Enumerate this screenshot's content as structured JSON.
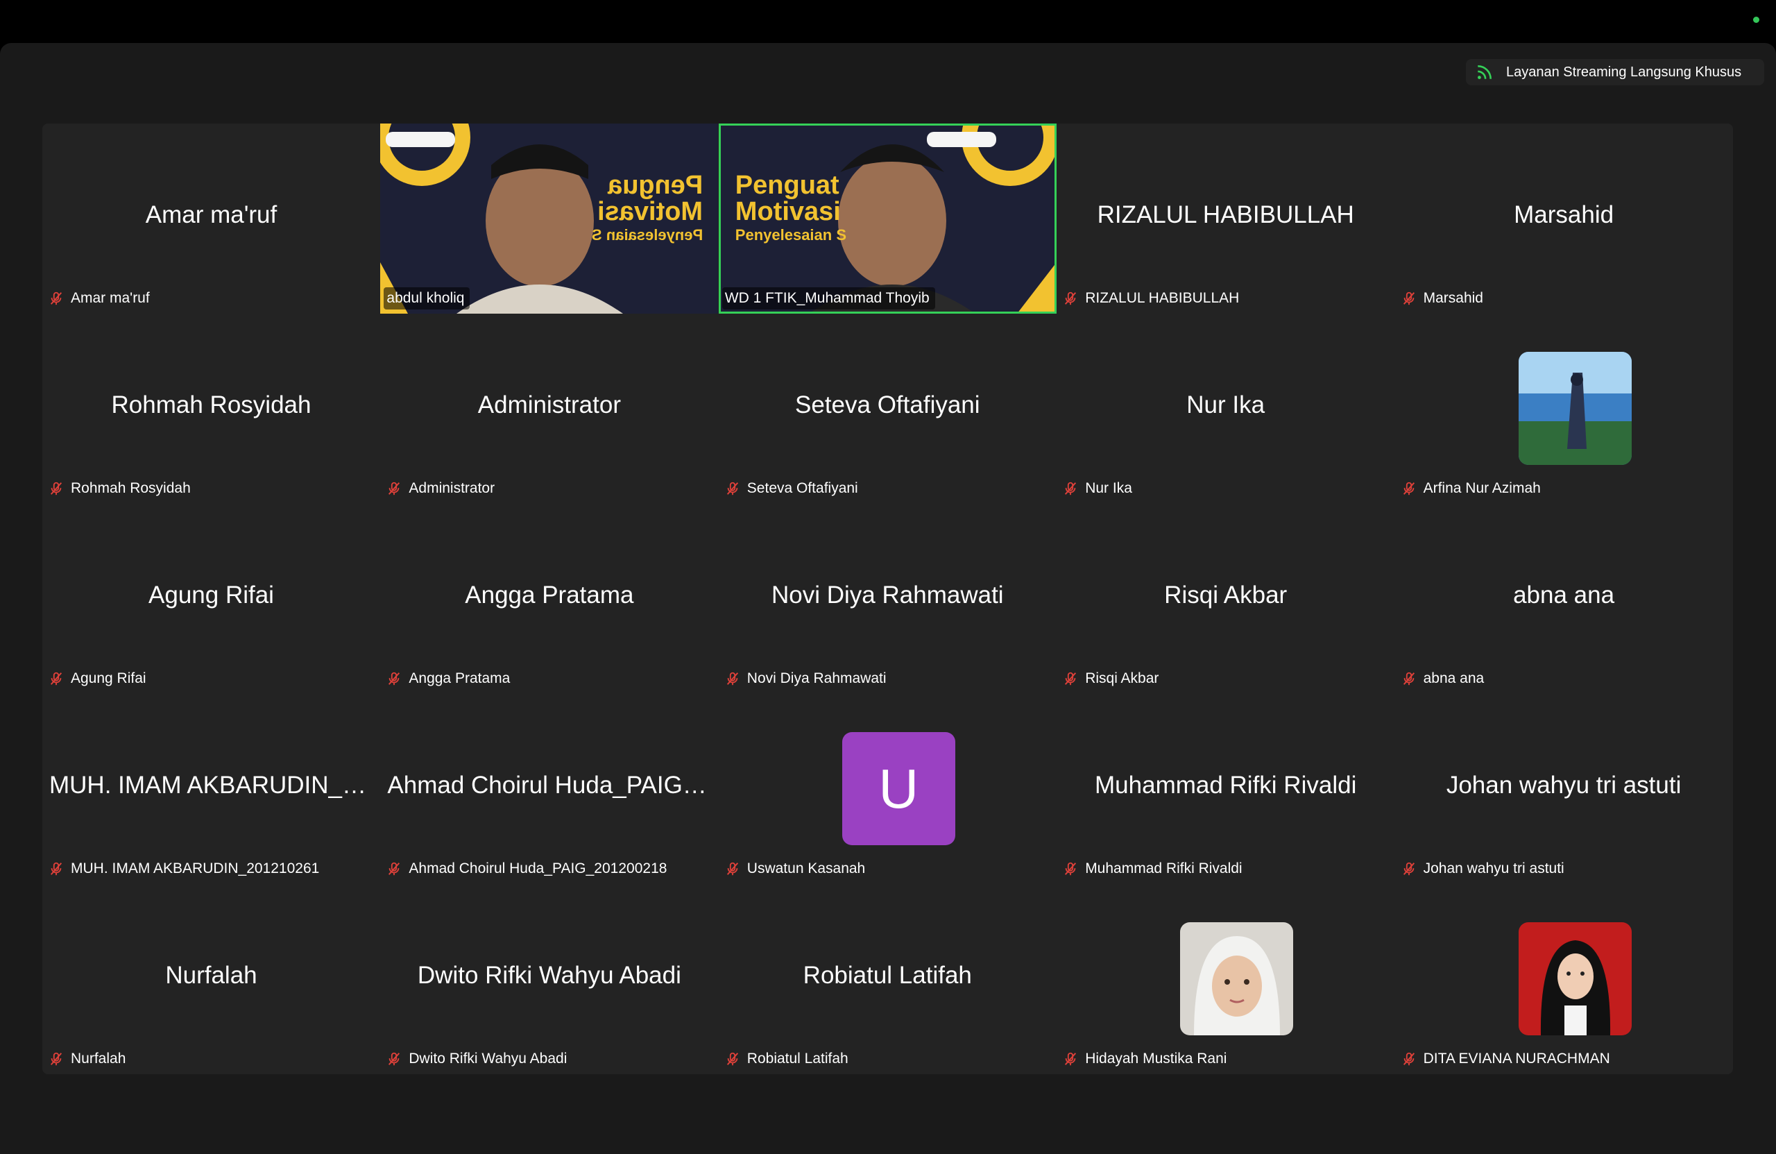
{
  "stream_badge": {
    "label": "Layanan Streaming Langsung Khusus",
    "icon": "broadcast-icon"
  },
  "colors": {
    "window_bg": "#1a1a1a",
    "tile_bg": "#232323",
    "active_speaker": "#35d058",
    "mute_red": "#e0413a",
    "letter_avatar": "#9a41c2"
  },
  "participants": [
    {
      "display": "Amar ma'ruf",
      "label": "Amar ma'ruf",
      "muted": true
    },
    {
      "display": "",
      "label": "abdul kholiq",
      "muted": false,
      "video": true,
      "video_text": [
        "Pengua",
        "Motivasi",
        "Penyelesaian S"
      ]
    },
    {
      "display": "",
      "label": "WD 1 FTIK_Muhammad Thoyib",
      "muted": false,
      "video": true,
      "active": true,
      "video_text": [
        "Penguat",
        "Motivasi",
        "Penyelesaian S"
      ]
    },
    {
      "display": "RIZALUL HABIBULLAH",
      "label": "RIZALUL HABIBULLAH",
      "muted": true
    },
    {
      "display": "Marsahid",
      "label": "Marsahid",
      "muted": true
    },
    {
      "display": "Rohmah Rosyidah",
      "label": "Rohmah Rosyidah",
      "muted": true
    },
    {
      "display": "Administrator",
      "label": "Administrator",
      "muted": true
    },
    {
      "display": "Seteva Oftafiyani",
      "label": "Seteva Oftafiyani",
      "muted": true
    },
    {
      "display": "Nur Ika",
      "label": "Nur Ika",
      "muted": true
    },
    {
      "display": "",
      "label": "Arfina Nur Azimah",
      "muted": true,
      "avatar": "photo-landscape"
    },
    {
      "display": "Agung Rifai",
      "label": "Agung Rifai",
      "muted": true
    },
    {
      "display": "Angga Pratama",
      "label": "Angga Pratama",
      "muted": true
    },
    {
      "display": "Novi Diya Rahmawati",
      "label": "Novi Diya Rahmawati",
      "muted": true
    },
    {
      "display": "Risqi Akbar",
      "label": "Risqi Akbar",
      "muted": true
    },
    {
      "display": "abna ana",
      "label": "abna ana",
      "muted": true
    },
    {
      "display": "MUH. IMAM AKBARUDIN_2...",
      "label": "MUH. IMAM AKBARUDIN_201210261",
      "muted": true
    },
    {
      "display": "Ahmad Choirul Huda_PAIG_...",
      "label": "Ahmad Choirul Huda_PAIG_201200218",
      "muted": true
    },
    {
      "display": "",
      "label": "Uswatun Kasanah",
      "muted": true,
      "avatar_letter": "U"
    },
    {
      "display": "Muhammad Rifki Rivaldi",
      "label": "Muhammad Rifki Rivaldi",
      "muted": true
    },
    {
      "display": "Johan wahyu tri astuti",
      "label": "Johan wahyu tri astuti",
      "muted": true
    },
    {
      "display": "Nurfalah",
      "label": "Nurfalah",
      "muted": true
    },
    {
      "display": "Dwito Rifki Wahyu Abadi",
      "label": "Dwito Rifki Wahyu Abadi",
      "muted": true
    },
    {
      "display": "Robiatul Latifah",
      "label": "Robiatul Latifah",
      "muted": true
    },
    {
      "display": "",
      "label": "Hidayah Mustika Rani",
      "muted": true,
      "avatar": "photo-hijab-light"
    },
    {
      "display": "",
      "label": "DITA EVIANA NURACHMAN",
      "muted": true,
      "avatar": "photo-hijab-red"
    }
  ]
}
